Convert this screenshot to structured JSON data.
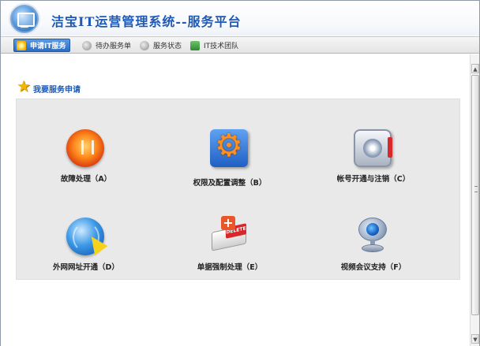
{
  "header": {
    "title": "洁宝IT运营管理系统--服务平台"
  },
  "tabs": [
    {
      "label": "申请IT服务",
      "icon": "star-icon",
      "active": true
    },
    {
      "label": "待办服务单",
      "icon": "pending-icon",
      "active": false
    },
    {
      "label": "服务状态",
      "icon": "status-icon",
      "active": false
    },
    {
      "label": "IT技术团队",
      "icon": "team-icon",
      "active": false
    }
  ],
  "section": {
    "title": "我要服务申请",
    "icon": "star-icon"
  },
  "services": [
    {
      "label": "故障处理（A）",
      "icon": "alarm-icon"
    },
    {
      "label": "权限及配置调整（B）",
      "icon": "gear-icon"
    },
    {
      "label": "帐号开通与注销（C）",
      "icon": "account-icon"
    },
    {
      "label": "外网网址开通（D）",
      "icon": "globe-icon"
    },
    {
      "label": "单据强制处理（E）",
      "icon": "eraser-icon"
    },
    {
      "label": "视频会议支持（F）",
      "icon": "webcam-icon"
    }
  ],
  "service_icon_badge": "DELETE",
  "colors": {
    "title_blue": "#1d59b5",
    "active_tab": "#2a6cc4",
    "panel_bg": "#e9e9e9"
  }
}
